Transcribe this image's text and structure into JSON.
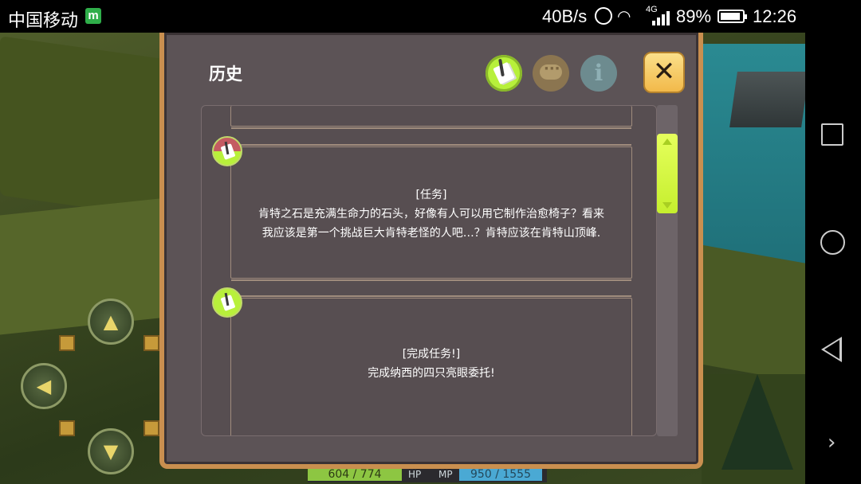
{
  "status_bar": {
    "carrier": "中国移动",
    "app_icon": "m",
    "net_speed": "40B/s",
    "network_type": "4G",
    "battery": "89%",
    "time": "12:26"
  },
  "dialog": {
    "title": "历史",
    "tabs": [
      {
        "name": "quest-tab",
        "icon": "quest-scroll-icon",
        "active": true
      },
      {
        "name": "chat-tab",
        "icon": "chat-bubble-icon",
        "active": false
      },
      {
        "name": "info-tab",
        "icon": "info-icon",
        "label": "i",
        "active": false
      }
    ],
    "close_label": "✕",
    "entries": [
      {
        "status": "incomplete",
        "heading": "[任务]",
        "lines": [
          "肯特之石是充满生命力的石头，好像有人可以用它制作治愈椅子？看来",
          "我应该是第一个挑战巨大肯特老怪的人吧…？肯特应该在肯特山顶峰."
        ]
      },
      {
        "status": "complete",
        "heading": "[完成任务!]",
        "lines": [
          "完成纳西的四只亮眼委托!"
        ]
      }
    ]
  },
  "hud": {
    "hp": "604 / 774",
    "hp_label": "HP",
    "mp_label": "MP",
    "mp": "950 / 1555",
    "hp_fraction": 0.78,
    "mp_fraction": 0.61
  },
  "colors": {
    "accent_green": "#b8f03b",
    "dialog_bg": "#5c5356",
    "frame_gold": "#c98f4f"
  }
}
